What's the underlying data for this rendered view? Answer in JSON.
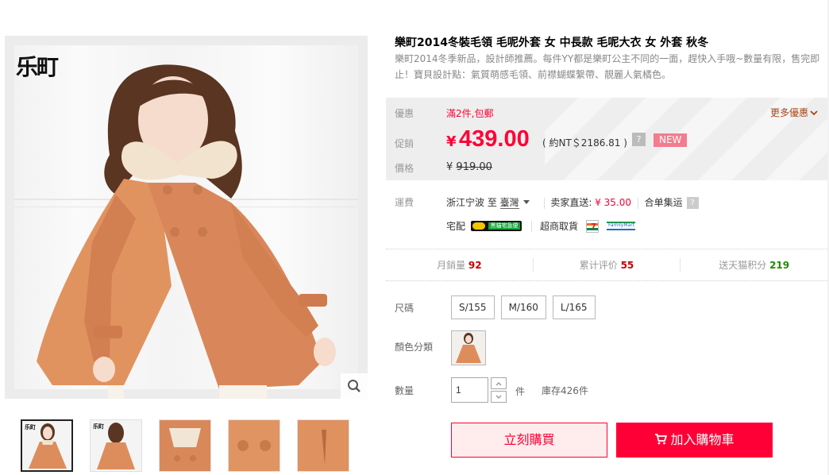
{
  "gallery": {
    "brand_logo": "乐町",
    "zoom_icon": "magnifier-icon",
    "thumbnails": [
      "front-view",
      "back-view",
      "collar-detail",
      "button-detail",
      "pocket-detail"
    ],
    "active_thumbnail": 0
  },
  "product": {
    "title": "樂町2014冬裝毛領 毛呢外套 女 中長款 毛呢大衣 女 外套 秋冬",
    "subtitle": "樂町2014冬季新品，設計師推薦。每件YY都是樂町公主不同的一面，趕快入手哦~數量有限，售完即止！寶貝設計點：氣質萌感毛領、前襟蝴蝶繫帶、靚麗人氣橘色。"
  },
  "pricing": {
    "promo_label": "優惠",
    "promo_text": "滿2件,包郵",
    "more_promo": "更多優惠",
    "sale_label": "促銷",
    "currency_symbol": "¥",
    "sale_price": "439.00",
    "approx_text": "( 約NT＄2186.81 )",
    "help_mark": "?",
    "new_badge": "NEW",
    "original_label": "價格",
    "original_currency": "¥",
    "original_price": "919.00",
    "accent_color": "#ff0036",
    "badge_color": "#f37c8e"
  },
  "shipping": {
    "label": "運費",
    "from": "浙江宁波 至",
    "to": "臺灣",
    "seller_direct": "卖家直送:",
    "cost": "¥ 35.00",
    "consolidate": "合单集运",
    "home_delivery": "宅配",
    "home_delivery_logo": "黑貓宅急便",
    "store_pickup": "超商取貨",
    "store_logos": [
      "7-ELEVEN",
      "FamilyMart"
    ]
  },
  "stats": [
    {
      "label": "月銷量",
      "value": "92",
      "tone": "red"
    },
    {
      "label": "累计评价",
      "value": "55",
      "tone": "red"
    },
    {
      "label": "送天猫积分",
      "value": "219",
      "tone": "green"
    }
  ],
  "options": {
    "size_label": "尺碼",
    "sizes": [
      "S/155",
      "M/160",
      "L/165"
    ],
    "color_label": "顏色分類",
    "qty_label": "數量",
    "qty_value": "1",
    "qty_unit": "件",
    "stock": "庫存426件"
  },
  "actions": {
    "buy_now": "立刻購買",
    "add_to_cart": "加入購物車"
  }
}
